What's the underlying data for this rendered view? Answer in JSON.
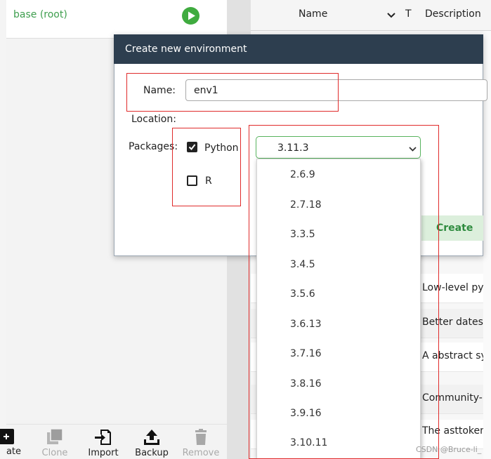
{
  "environments": {
    "selected": "base (root)"
  },
  "toolbar": {
    "buttons": [
      {
        "label": "ate",
        "icon": "plus-icon"
      },
      {
        "label": "Clone",
        "icon": "clone-icon"
      },
      {
        "label": "Import",
        "icon": "import-icon"
      },
      {
        "label": "Backup",
        "icon": "backup-icon"
      },
      {
        "label": "Remove",
        "icon": "trash-icon"
      }
    ]
  },
  "package_table": {
    "columns": [
      "Name",
      "T",
      "Description"
    ],
    "rows": [
      {
        "description": "Low-level py"
      },
      {
        "description": "Better dates"
      },
      {
        "description": "A abstract sy"
      },
      {
        "description": "Community-"
      },
      {
        "description": "The asttoken"
      }
    ]
  },
  "dialog": {
    "title": "Create new environment",
    "name_label": "Name:",
    "name_value": "env1",
    "location_label": "Location:",
    "packages_label": "Packages:",
    "python_label": "Python",
    "python_checked": true,
    "r_label": "R",
    "r_checked": false,
    "python_version": "3.11.3",
    "create_label": "Create"
  },
  "version_dropdown": {
    "options": [
      "2.6.9",
      "2.7.18",
      "3.3.5",
      "3.4.5",
      "3.5.6",
      "3.6.13",
      "3.7.16",
      "3.8.16",
      "3.9.16",
      "3.10.11"
    ]
  },
  "watermark": "CSDN @Bruce-li_",
  "colors": {
    "accent_green": "#3e9e4e",
    "dialog_titlebar": "#2d3e4f",
    "annotation_red": "#e02b2b"
  }
}
